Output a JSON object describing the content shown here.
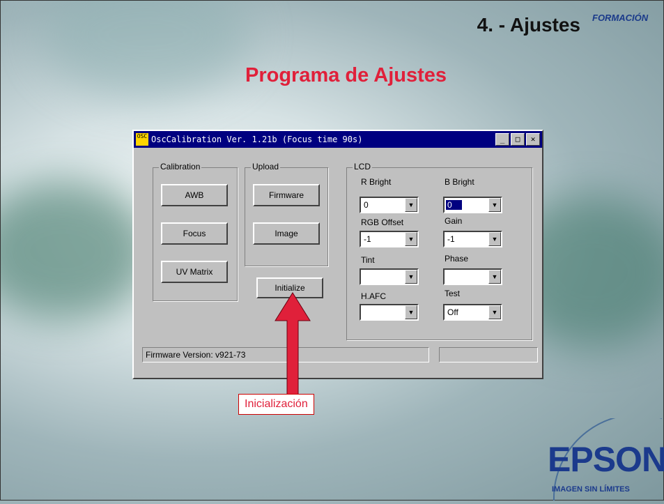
{
  "slide": {
    "section_title": "4. - Ajustes",
    "brand_corner": "FORMACIÓN",
    "subtitle": "Programa de Ajustes",
    "callout": "Inicialización"
  },
  "window": {
    "title": "OscCalibration  Ver. 1.21b  (Focus time 90s)",
    "icon_text": "OSC",
    "minimize": "_",
    "maximize": "□",
    "close": "✕"
  },
  "calibration": {
    "label": "Calibration",
    "awb": "AWB",
    "focus": "Focus",
    "uv_matrix": "UV Matrix"
  },
  "upload": {
    "label": "Upload",
    "firmware": "Firmware",
    "image": "Image"
  },
  "initialize": "Initialize",
  "lcd": {
    "label": "LCD",
    "r_bright": {
      "label": "R Bright",
      "value": "0"
    },
    "b_bright": {
      "label": "B Bright",
      "value": "0"
    },
    "rgb_offset": {
      "label": "RGB Offset",
      "value": "-1"
    },
    "gain": {
      "label": "Gain",
      "value": "-1"
    },
    "tint": {
      "label": "Tint",
      "value": ""
    },
    "phase": {
      "label": "Phase",
      "value": ""
    },
    "h_afc": {
      "label": "H.AFC",
      "value": ""
    },
    "test": {
      "label": "Test",
      "value": "Off"
    }
  },
  "status": {
    "firmware_version": "Firmware Version: v921-73",
    "right": ""
  },
  "logo": {
    "name": "EPSON",
    "tagline": "IMAGEN SIN LÍMITES"
  },
  "colors": {
    "title_bar": "#000080",
    "subtitle": "#e0203a",
    "arrow": "#e0203a",
    "brand": "#1a3a8a"
  }
}
